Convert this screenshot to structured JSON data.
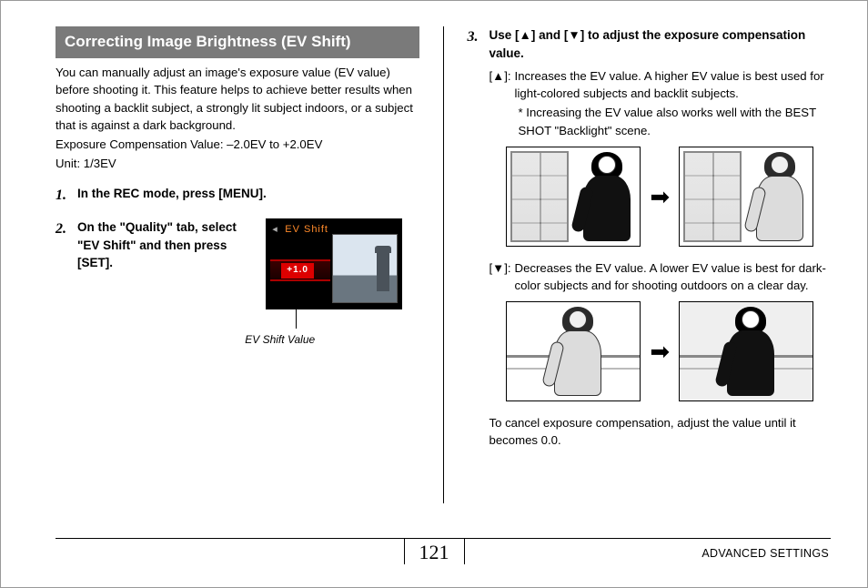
{
  "header": {
    "title": "Correcting Image Brightness (EV Shift)"
  },
  "intro": {
    "para": "You can manually adjust an image's exposure value (EV value) before shooting it. This feature helps to achieve better results when shooting a backlit subject, a strongly lit subject indoors, or a subject that is against a dark background.",
    "line1": "Exposure Compensation Value: –2.0EV to +2.0EV",
    "line2": "Unit: 1/3EV"
  },
  "steps": {
    "s1": {
      "num": "1.",
      "title": "In the REC mode, press [MENU]."
    },
    "s2": {
      "num": "2.",
      "title": "On the \"Quality\" tab, select \"EV Shift\" and then press [SET]."
    },
    "s3": {
      "num": "3.",
      "title": "Use [▲] and [▼] to adjust the exposure compensation value."
    }
  },
  "screenshot": {
    "title": "EV Shift",
    "value": "+1.0",
    "caption": "EV Shift Value"
  },
  "defs": {
    "upKey": "[▲]:",
    "upText": "Increases the EV value. A higher EV value is best used for light-colored subjects and backlit subjects.",
    "upNote": "* Increasing the EV value also works well with the BEST SHOT \"Backlight\" scene.",
    "downKey": "[▼]:",
    "downText": "Decreases the EV value. A lower EV value is best for dark-color subjects and for shooting outdoors on a clear day."
  },
  "arrow": "➡",
  "cancelNote": "To cancel exposure compensation, adjust the value until it becomes 0.0.",
  "footer": {
    "page": "121",
    "section": "ADVANCED SETTINGS"
  }
}
